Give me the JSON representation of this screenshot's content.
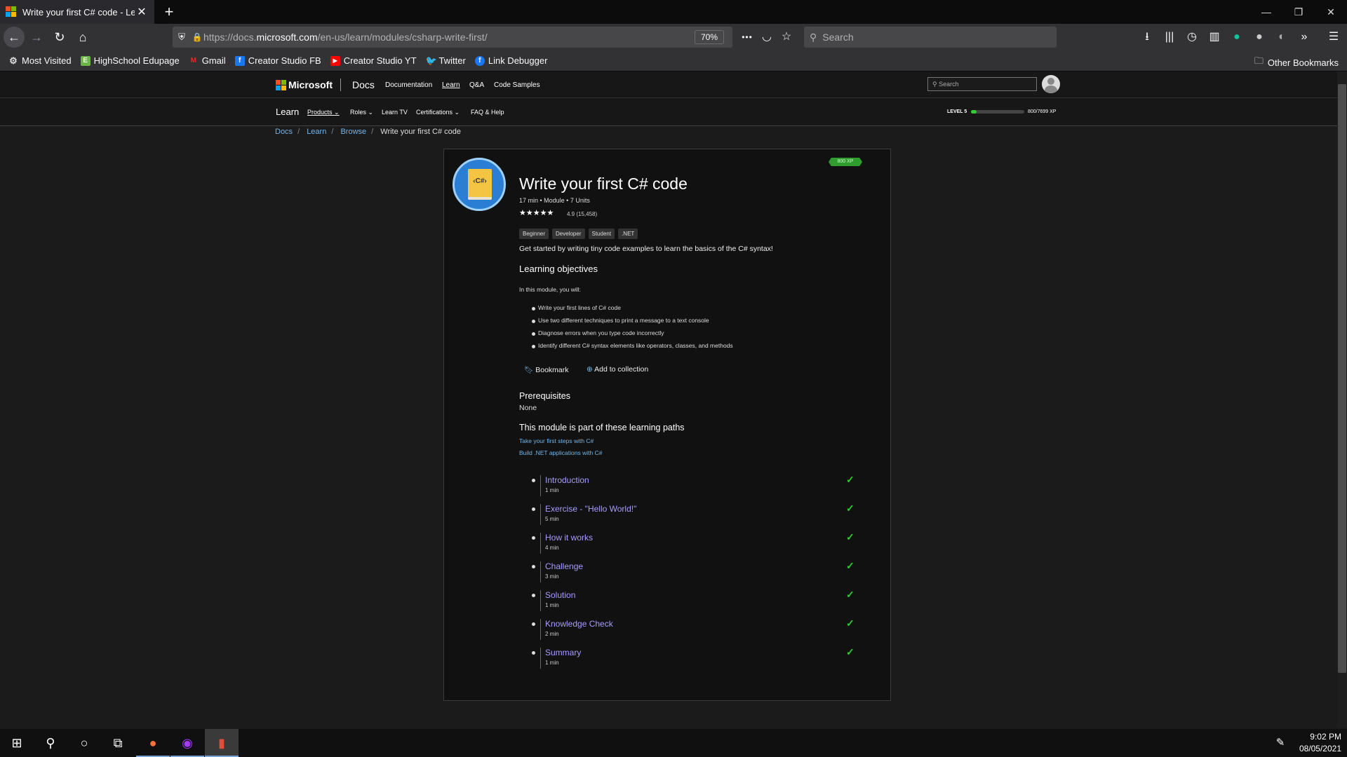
{
  "browser": {
    "tab_title": "Write your first C# code - Learn",
    "tab_close": "✕",
    "new_tab": "+",
    "window_min": "—",
    "window_restore": "❐",
    "window_close": "✕",
    "url_prefix": "https://docs.",
    "url_host": "microsoft.com",
    "url_path": "/en-us/learn/modules/csharp-write-first/",
    "zoom": "70%",
    "search_placeholder": "Search",
    "page_actions": "•••",
    "bookmarks": [
      {
        "label": "Most Visited",
        "icon": "gear-icon",
        "color": "#5a5a5a"
      },
      {
        "label": "HighSchool Edupage",
        "icon": "edupage-icon",
        "color": "#6bb54a"
      },
      {
        "label": "Gmail",
        "icon": "gmail-icon",
        "color": "#d93025"
      },
      {
        "label": "Creator Studio FB",
        "icon": "facebook-icon",
        "color": "#1877f2"
      },
      {
        "label": "Creator Studio YT",
        "icon": "youtube-icon",
        "color": "#ff0000"
      },
      {
        "label": "Twitter",
        "icon": "twitter-icon",
        "color": "#1da1f2"
      },
      {
        "label": "Link Debugger",
        "icon": "facebook-icon",
        "color": "#1877f2"
      }
    ],
    "other_bookmarks": "Other Bookmarks"
  },
  "header": {
    "brand": "Microsoft",
    "site": "Docs",
    "links": [
      "Documentation",
      "Learn",
      "Q&A",
      "Code Samples"
    ],
    "search_placeholder": "Search"
  },
  "subnav": {
    "title": "Learn",
    "items": [
      "Products",
      "Roles",
      "Learn TV",
      "Certifications",
      "FAQ & Help"
    ],
    "level": "LEVEL 5",
    "xp": "800/7699 XP",
    "xp_progress": 0.104
  },
  "breadcrumb": [
    "Docs",
    "Learn",
    "Browse",
    "Write your first C# code"
  ],
  "module": {
    "badge": "800 XP",
    "icon_text": "‹C#›",
    "title": "Write your first C# code",
    "meta": "17 min • Module • 7 Units",
    "rating_stars": "★★★★★",
    "rating": "4.9 (15,458)",
    "tags": [
      "Beginner",
      "Developer",
      "Student",
      ".NET"
    ],
    "summary": "Get started by writing tiny code examples to learn the basics of the C# syntax!",
    "objectives_heading": "Learning objectives",
    "objectives_intro": "In this module, you will:",
    "objectives": [
      "Write your first lines of C# code",
      "Use two different techniques to print a message to a text console",
      "Diagnose errors when you type code incorrectly",
      "Identify different C# syntax elements like operators, classes, and methods"
    ],
    "bookmark_label": "Bookmark",
    "collection_label": "Add to collection",
    "prereq_heading": "Prerequisites",
    "prereq_value": "None",
    "paths_heading": "This module is part of these learning paths",
    "paths": [
      "Take your first steps with C#",
      "Build .NET applications with C#"
    ],
    "units": [
      {
        "title": "Introduction",
        "time": "1 min"
      },
      {
        "title": "Exercise - \"Hello World!\"",
        "time": "5 min"
      },
      {
        "title": "How it works",
        "time": "4 min"
      },
      {
        "title": "Challenge",
        "time": "3 min"
      },
      {
        "title": "Solution",
        "time": "1 min"
      },
      {
        "title": "Knowledge Check",
        "time": "2 min"
      },
      {
        "title": "Summary",
        "time": "1 min"
      }
    ]
  },
  "taskbar": {
    "time": "9:02 PM",
    "date": "08/05/2021"
  },
  "colors": {
    "accent_link": "#75b6e7",
    "unit_link": "#a79cff",
    "check": "#33cc33",
    "xp_badge": "#2f9e2f"
  }
}
